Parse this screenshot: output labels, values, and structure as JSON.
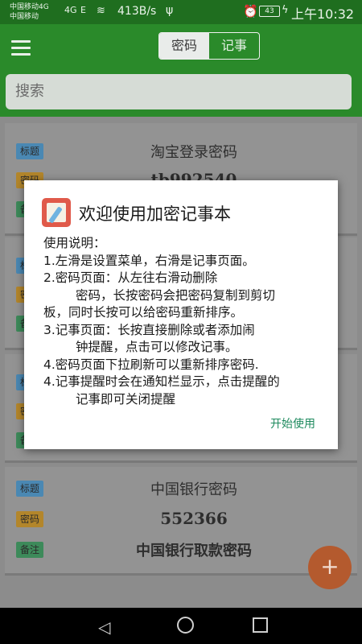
{
  "status": {
    "carrier1": "中国移动4G",
    "carrier2": "中国移动",
    "sig1": "4G",
    "sig2": "E",
    "speed": "413B/s",
    "battery": "43",
    "time": "上午10:32"
  },
  "appbar": {
    "tab_password": "密码",
    "tab_notes": "记事"
  },
  "search": {
    "placeholder": "搜索"
  },
  "tags": {
    "title": "标题",
    "password": "密码",
    "note": "备注"
  },
  "cards": [
    {
      "title": "淘宝登录密码",
      "password": "tb992540",
      "note": ""
    },
    {
      "title": "中国银行密码",
      "password": "552366",
      "note": "中国银行取款密码"
    }
  ],
  "fab": {
    "label": "+"
  },
  "dialog": {
    "title": "欢迎使用加密记事本",
    "lines": [
      "使用说明：",
      "1.左滑是设置菜单，右滑是记事页面。",
      "2.密码页面：从左往右滑动删除",
      "密码，长按密码会把密码复制到剪切",
      "板，同时长按可以给密码重新排序。",
      "3.记事页面：长按直接删除或者添加闹",
      "钟提醒，点击可以修改记事。",
      "4.密码页面下拉刷新可以重新排序密码.",
      "4.记事提醒时会在通知栏显示，点击提醒的",
      "记事即可关闭提醒"
    ],
    "button": "开始使用"
  },
  "colors": {
    "accent_green": "#2a8a2a",
    "fab": "#b45a2e",
    "dialog_button": "#1e8a5e"
  },
  "icons": {
    "menu": "hamburger-icon",
    "fab": "plus-icon",
    "nav_back": "back-triangle-icon",
    "nav_home": "home-circle-icon",
    "nav_recent": "recent-square-icon",
    "dialog": "notepad-app-icon"
  }
}
